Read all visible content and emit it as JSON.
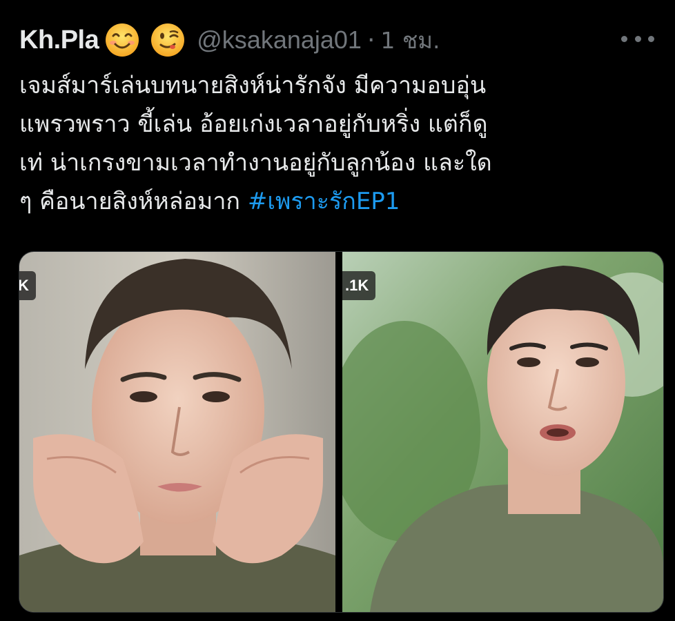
{
  "tweet": {
    "display_name": "Kh.Pla",
    "emojis": [
      "smiling-face-icon",
      "winking-face-icon"
    ],
    "handle": "@ksakanaja01",
    "separator": "·",
    "time": "1 ชม.",
    "text_lines": [
      "เจมส์มาร์เล่นบทนายสิงห์น่ารักจัง มีความอบอุ่น",
      "แพรวพราว ขี้เล่น อ้อยเก่งเวลาอยู่กับหริ่ง แต่ก็ดู",
      "เท่ น่าเกรงขามเวลาทำงานอยู่กับลูกน้อง และใด",
      "ๆ คือนายสิงห์หล่อมาก "
    ],
    "hashtag": "#เพราะรักEP1",
    "media": [
      {
        "badge": "K",
        "icon": "man-portrait-image"
      },
      {
        "badge": ".1K",
        "icon": "man-portrait-image"
      }
    ]
  },
  "colors": {
    "background": "#000000",
    "text": "#e7e9ea",
    "secondary": "#71767b",
    "link": "#1d9bf0"
  }
}
